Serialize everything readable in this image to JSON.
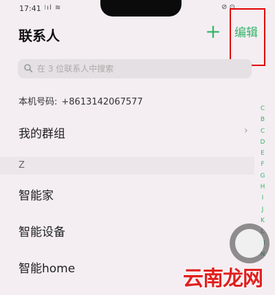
{
  "status_bar": {
    "time": "17:41",
    "icons": "⁝ıl ≋",
    "right_icons": "⊘ ⊙"
  },
  "header": {
    "title": "联系人",
    "add_label": "+",
    "edit_label": "编辑"
  },
  "search": {
    "placeholder": "在 3 位联系人中搜索"
  },
  "local_number": {
    "label": "本机号码:",
    "value": "+8613142067577"
  },
  "groups": {
    "label": "我的群组",
    "chevron": "›"
  },
  "section": {
    "letter": "Z"
  },
  "contacts": [
    {
      "name": "智能家"
    },
    {
      "name": "智能设备"
    },
    {
      "name": "智能home"
    }
  ],
  "index_letters": [
    "C",
    "B",
    "C",
    "D",
    "E",
    "F",
    "G",
    "H",
    "I",
    "J",
    "K",
    "L",
    "M",
    "N"
  ],
  "watermark": "云南龙网",
  "colors": {
    "accent": "#35b56a",
    "highlight": "#e10000",
    "watermark": "#e02020"
  }
}
